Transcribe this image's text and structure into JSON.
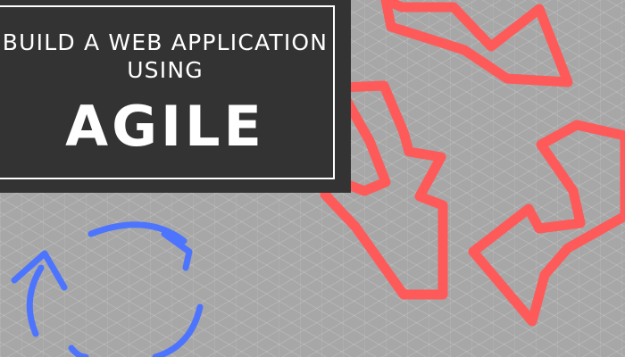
{
  "title": {
    "line1": "BUILD A WEB APPLICATION",
    "line2": "USING",
    "line3": "AGILE"
  },
  "colors": {
    "background": "#a7a7a7",
    "title_box": "#333333",
    "title_text": "#ffffff",
    "recycle_arrows": "#ff5a5a",
    "cycle_arrows": "#4d74ff"
  },
  "icons": {
    "recycle": "recycle-arrows-icon",
    "cycle": "circular-arrows-icon"
  }
}
